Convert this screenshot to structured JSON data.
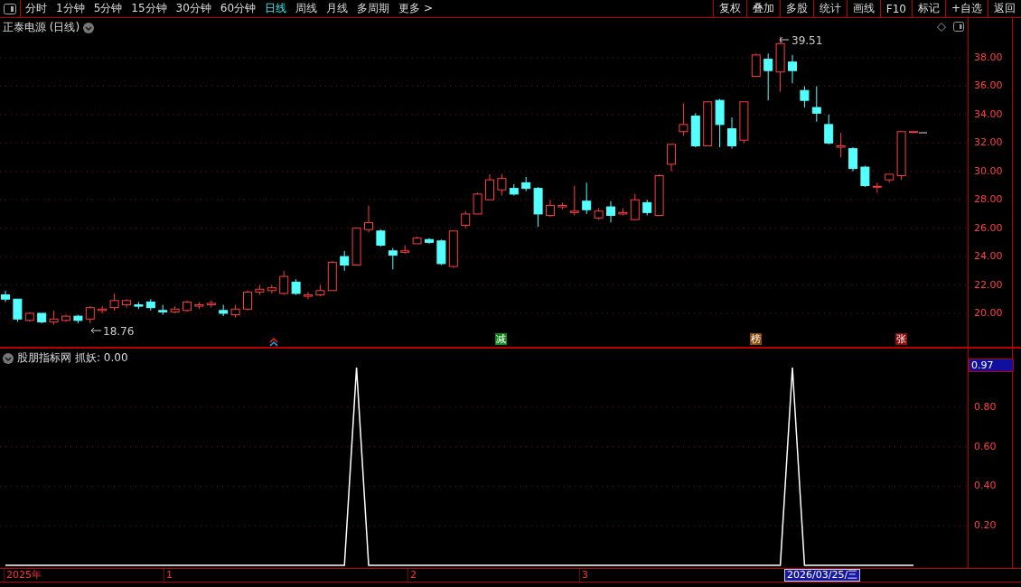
{
  "toolbar": {
    "tabs": [
      {
        "label": "分时",
        "selected": false
      },
      {
        "label": "1分钟",
        "selected": false
      },
      {
        "label": "5分钟",
        "selected": false
      },
      {
        "label": "15分钟",
        "selected": false
      },
      {
        "label": "30分钟",
        "selected": false
      },
      {
        "label": "60分钟",
        "selected": false
      },
      {
        "label": "日线",
        "selected": true
      },
      {
        "label": "周线",
        "selected": false
      },
      {
        "label": "月线",
        "selected": false
      },
      {
        "label": "多周期",
        "selected": false
      },
      {
        "label": "更多 >",
        "selected": false
      }
    ],
    "buttons": [
      "复权",
      "叠加",
      "多股",
      "统计",
      "画线",
      "F10",
      "标记",
      "+自选",
      "返回"
    ]
  },
  "main_chart": {
    "title": "正泰电源 (日线)",
    "high_label": "39.51",
    "low_label": "18.76",
    "signals": [
      {
        "text": "减",
        "color": "#0f8a1a"
      },
      {
        "text": "榜",
        "color": "#8a4a0c"
      },
      {
        "text": "张",
        "color": "#8c0c0c"
      }
    ],
    "chart_data": {
      "type": "candlestick",
      "grid": true,
      "ylim": [
        17.58,
        40.8
      ],
      "yticks": [
        {
          "value": 38,
          "label": "38.00"
        },
        {
          "value": 36,
          "label": "36.00"
        },
        {
          "value": 34,
          "label": "34.00"
        },
        {
          "value": 32,
          "label": "32.00"
        },
        {
          "value": 30,
          "label": "30.00"
        },
        {
          "value": 28,
          "label": "28.00"
        },
        {
          "value": 26,
          "label": "26.00"
        },
        {
          "value": 24,
          "label": "24.00"
        },
        {
          "value": 22,
          "label": "22.00"
        },
        {
          "value": 20,
          "label": "20.00"
        }
      ],
      "ohlc": [
        [
          21.3,
          21.6,
          20.8,
          21
        ],
        [
          21,
          21,
          19.4,
          19.6
        ],
        [
          19.5,
          20.1,
          19.4,
          20
        ],
        [
          20,
          20,
          19.3,
          19.4
        ],
        [
          19.4,
          20.2,
          19.2,
          19.6
        ],
        [
          19.5,
          19.9,
          19.4,
          19.8
        ],
        [
          19.8,
          19.9,
          19.3,
          19.5
        ],
        [
          19.6,
          20.5,
          19.3,
          20.4
        ],
        [
          20.2,
          20.5,
          20,
          20.3
        ],
        [
          20.4,
          21.4,
          20.2,
          20.9
        ],
        [
          20.6,
          21,
          20.4,
          20.9
        ],
        [
          20.6,
          20.8,
          20.3,
          20.5
        ],
        [
          20.8,
          21,
          20.2,
          20.4
        ],
        [
          20.2,
          20.6,
          19.9,
          20.1
        ],
        [
          20.1,
          20.5,
          20,
          20.3
        ],
        [
          20.2,
          20.9,
          20.1,
          20.8
        ],
        [
          20.5,
          20.8,
          20.3,
          20.6
        ],
        [
          20.6,
          20.9,
          20.4,
          20.7
        ],
        [
          20.2,
          20.6,
          19.8,
          20
        ],
        [
          19.9,
          20.6,
          19.7,
          20.3
        ],
        [
          20.3,
          21.6,
          20.2,
          21.5
        ],
        [
          21.5,
          22,
          21.3,
          21.7
        ],
        [
          21.6,
          22,
          21.4,
          21.8
        ],
        [
          21.4,
          23,
          21.3,
          22.6
        ],
        [
          22.2,
          22.4,
          21.3,
          21.4
        ],
        [
          21.2,
          21.5,
          21,
          21.3
        ],
        [
          21.3,
          22,
          21.2,
          21.6
        ],
        [
          21.6,
          23.7,
          21.6,
          23.6
        ],
        [
          24,
          24.4,
          23,
          23.4
        ],
        [
          23.4,
          26,
          23.4,
          26
        ],
        [
          25.9,
          27.6,
          25.7,
          26.4
        ],
        [
          25.8,
          25.9,
          24.7,
          24.8
        ],
        [
          24.4,
          24.6,
          23.1,
          24.1
        ],
        [
          24.3,
          24.8,
          24.2,
          24.4
        ],
        [
          24.9,
          25.4,
          24.9,
          25.3
        ],
        [
          25.2,
          25.3,
          24.9,
          25
        ],
        [
          25.1,
          25.2,
          23.4,
          23.5
        ],
        [
          23.3,
          25.8,
          23.2,
          25.8
        ],
        [
          26.2,
          27.2,
          26,
          27
        ],
        [
          27,
          28.5,
          27,
          28.4
        ],
        [
          28,
          29.8,
          28,
          29.4
        ],
        [
          28.7,
          29.8,
          28.3,
          29.5
        ],
        [
          28.8,
          29.1,
          28.3,
          28.4
        ],
        [
          29.2,
          29.6,
          28.6,
          28.8
        ],
        [
          28.8,
          28.9,
          26.1,
          27
        ],
        [
          26.9,
          28,
          26.8,
          27.6
        ],
        [
          27.5,
          27.8,
          27.3,
          27.6
        ],
        [
          27.1,
          29,
          26.9,
          27.2
        ],
        [
          27.9,
          29.2,
          27,
          27.3
        ],
        [
          26.7,
          27.4,
          26.6,
          27.2
        ],
        [
          27.5,
          27.9,
          26.4,
          26.9
        ],
        [
          27,
          27.4,
          26.9,
          27.1
        ],
        [
          26.6,
          28.4,
          26.6,
          28
        ],
        [
          27.8,
          28,
          26.9,
          27.1
        ],
        [
          26.9,
          29.8,
          26.9,
          29.7
        ],
        [
          30.5,
          31.9,
          30,
          31.9
        ],
        [
          32.8,
          34.8,
          32.5,
          33.3
        ],
        [
          33.9,
          34.1,
          31.7,
          31.8
        ],
        [
          31.8,
          34.9,
          31.8,
          34.9
        ],
        [
          35,
          35.1,
          31.7,
          33.3
        ],
        [
          33,
          33.8,
          31.6,
          31.8
        ],
        [
          32.2,
          34.9,
          32,
          34.9
        ],
        [
          36.7,
          38.3,
          36.7,
          38.2
        ],
        [
          37.9,
          38.3,
          35,
          37.1
        ],
        [
          37,
          39.5,
          35.6,
          39
        ],
        [
          37.7,
          38.2,
          36.2,
          37.1
        ],
        [
          35.7,
          36,
          34.5,
          35
        ],
        [
          34.5,
          36,
          33.5,
          34.1
        ],
        [
          33.3,
          34,
          31.9,
          32
        ],
        [
          31.7,
          32.7,
          31,
          31.8
        ],
        [
          31.6,
          31.7,
          30,
          30.2
        ],
        [
          30.3,
          30.4,
          28.9,
          29
        ],
        [
          28.9,
          29.2,
          28.5,
          28.95
        ],
        [
          29.4,
          29.8,
          29.2,
          29.8
        ],
        [
          29.7,
          32.8,
          29.4,
          32.8
        ],
        [
          32.8,
          32.8,
          32.8,
          32.8
        ]
      ]
    }
  },
  "indicator": {
    "title": "股朋指标网",
    "reading": ": 0.00",
    "current_value": "0.97",
    "chart_data": {
      "type": "line",
      "grid": true,
      "ylim": [
        -0.018,
        1.096
      ],
      "yticks": [
        {
          "value": 0.2,
          "label": "0.20"
        },
        {
          "value": 0.4,
          "label": "0.40"
        },
        {
          "value": 0.6,
          "label": "0.60"
        },
        {
          "value": 0.8,
          "label": "0.80"
        }
      ],
      "series": [
        {
          "name": "抓妖",
          "color": "#ffffff",
          "values": [
            0,
            0,
            0,
            0,
            0,
            0,
            0,
            0,
            0,
            0,
            0,
            0,
            0,
            0,
            0,
            0,
            0,
            0,
            0,
            0,
            0,
            0,
            0,
            0,
            0,
            0,
            0,
            0,
            0,
            1,
            0,
            0,
            0,
            0,
            0,
            0,
            0,
            0,
            0,
            0,
            0,
            0,
            0,
            0,
            0,
            0,
            0,
            0,
            0,
            0,
            0,
            0,
            0,
            0,
            0,
            0,
            0,
            0,
            0,
            0,
            0,
            0,
            0,
            0,
            0,
            1,
            0,
            0,
            0,
            0,
            0,
            0,
            0,
            0,
            0,
            0
          ]
        }
      ]
    }
  },
  "time_axis": [
    {
      "label": "2025年",
      "selected": false
    },
    {
      "label": "1",
      "selected": false
    },
    {
      "label": "2",
      "selected": false
    },
    {
      "label": "3",
      "selected": false
    },
    {
      "label": "2026/03/25/三",
      "selected": true
    }
  ]
}
